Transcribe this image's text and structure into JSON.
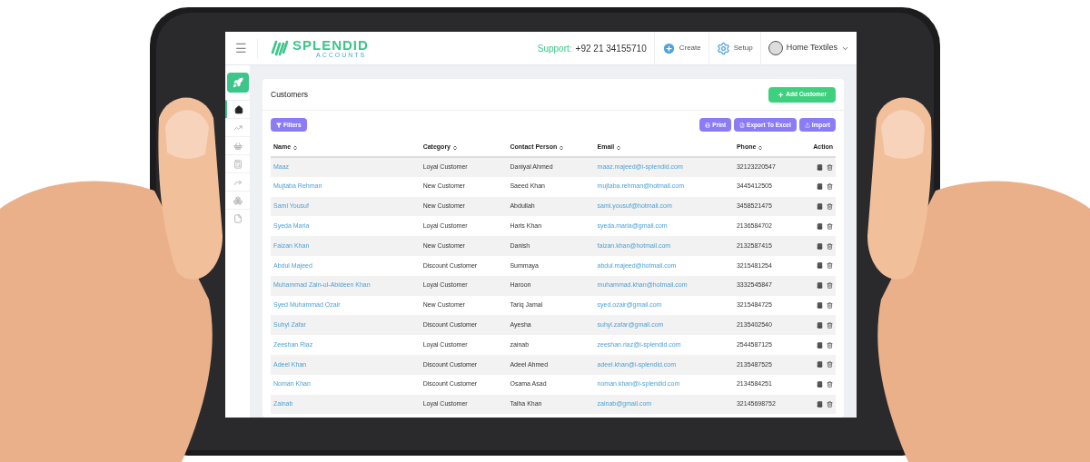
{
  "header": {
    "menu_label": "☰",
    "logo": {
      "name": "SPLENDID",
      "tagline": "ACCOUNTS"
    },
    "support_label": "Support:",
    "support_phone": "+92 21 34155710",
    "create": "Create",
    "setup": "Setup",
    "company": "Home Textiles"
  },
  "sidebar": {
    "items": [
      {
        "kind": "home",
        "selected": true
      },
      {
        "kind": "chart",
        "selected": false
      },
      {
        "kind": "basket",
        "selected": false
      },
      {
        "kind": "calculator",
        "selected": false
      },
      {
        "kind": "share",
        "selected": false
      },
      {
        "kind": "cubes",
        "selected": false
      },
      {
        "kind": "file",
        "selected": false
      }
    ]
  },
  "card": {
    "title": "Customers",
    "add_button": "Add Customer",
    "filters_button": "Filters",
    "actions": [
      {
        "kind": "print",
        "label": "Print"
      },
      {
        "kind": "excel",
        "label": "Export To Excel"
      },
      {
        "kind": "import",
        "label": "Import"
      }
    ]
  },
  "table": {
    "columns": [
      {
        "label": "Name",
        "sortable": true
      },
      {
        "label": "Category",
        "sortable": true
      },
      {
        "label": "Contact Person",
        "sortable": true
      },
      {
        "label": "Email",
        "sortable": true
      },
      {
        "label": "Phone",
        "sortable": true
      },
      {
        "label": "Action",
        "sortable": false
      }
    ],
    "rows": [
      [
        "Maaz",
        "Loyal Customer",
        "Daniyal Ahmed",
        "maaz.majeed@i-splendid.com",
        "32123220547"
      ],
      [
        "Mujtaba Rehman",
        "New Customer",
        "Saeed Khan",
        "mujtaba.rehman@hotmail.com",
        "3445412505"
      ],
      [
        "Sami Yousuf",
        "New Customer",
        "Abdullah",
        "sami.yousuf@hotmail.com",
        "3458521475"
      ],
      [
        "Syeda Maria",
        "Loyal Customer",
        "Haris Khan",
        "syeda.maria@gmail.com",
        "2136584702"
      ],
      [
        "Faizan Khan",
        "New Customer",
        "Danish",
        "faizan.khan@hotmail.com",
        "2132587415"
      ],
      [
        "Abdul Majeed",
        "Discount Customer",
        "Summaya",
        "abdul.majeed@hotmail.com",
        "3215481254"
      ],
      [
        "Muhammad Zain-ul-Abideen Khan",
        "Loyal Customer",
        "Haroon",
        "muhammad.khan@hotmail.com",
        "3332545847"
      ],
      [
        "Syed Muhammad Ozair",
        "New Customer",
        "Tariq Jamal",
        "syed.ozair@gmail.com",
        "3215484725"
      ],
      [
        "Suhyl Zafar",
        "Discount Customer",
        "Ayesha",
        "suhyl.zafar@gmail.com",
        "2135402540"
      ],
      [
        "Zeeshan Riaz",
        "Loyal Customer",
        "zainab",
        "zeeshan.riaz@i-splendid.com",
        "2544587125"
      ],
      [
        "Adeel Khan",
        "Discount Customer",
        "Adeel Ahmed",
        "adeel.khan@i-splendid.com",
        "2135487525"
      ],
      [
        "Noman Khan",
        "Discount Customer",
        "Osama Asad",
        "noman.khan@i-splendid.com",
        "2134584251"
      ],
      [
        "Zainab",
        "Loyal Customer",
        "Talha Khan",
        "zainab@gmail.com",
        "32145698752"
      ]
    ]
  }
}
